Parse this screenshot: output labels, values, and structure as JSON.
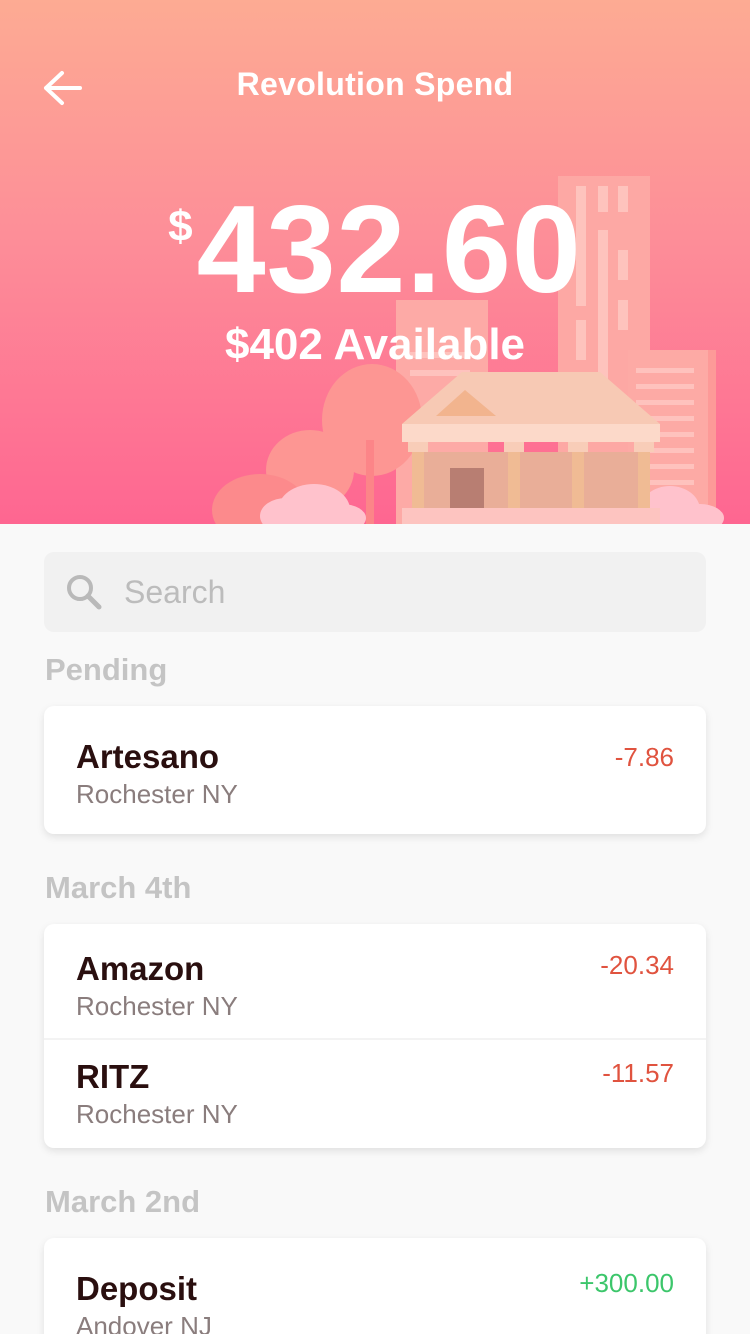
{
  "header": {
    "title": "Revolution Spend",
    "currency_symbol": "$",
    "balance": "432.60",
    "available": "$402 Available"
  },
  "search": {
    "placeholder": "Search"
  },
  "sections": [
    {
      "label": "Pending",
      "transactions": [
        {
          "name": "Artesano",
          "location": "Rochester NY",
          "amount": "-7.86"
        }
      ]
    },
    {
      "label": "March 4th",
      "transactions": [
        {
          "name": "Amazon",
          "location": "Rochester NY",
          "amount": "-20.34"
        },
        {
          "name": "RITZ",
          "location": "Rochester NY",
          "amount": "-11.57"
        }
      ]
    },
    {
      "label": "March 2nd",
      "transactions": [
        {
          "name": "Deposit",
          "location": "Andover NJ",
          "amount": "+300.00"
        }
      ]
    }
  ],
  "colors": {
    "negative": "#e0533f",
    "positive": "#3cc66b",
    "header_top": "#fdab93",
    "header_bottom": "#fe6691"
  },
  "icons": {
    "back": "arrow-left-icon",
    "search": "search-icon",
    "illustration": "city-bank-illustration"
  }
}
